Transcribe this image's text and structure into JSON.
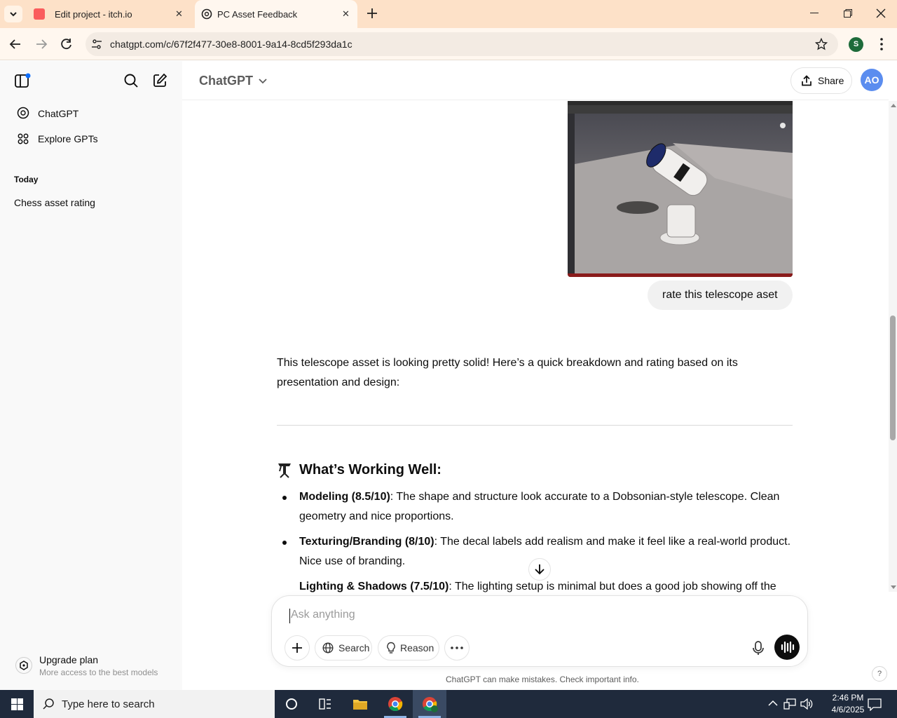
{
  "browser": {
    "tabs": [
      {
        "title": "Edit project - itch.io",
        "active": false
      },
      {
        "title": "PC Asset Feedback",
        "active": true
      }
    ],
    "url": "chatgpt.com/c/67f2f477-30e8-8001-9a14-8cd5f293da1c",
    "profile_initial": "S"
  },
  "sidebar": {
    "items": [
      {
        "label": "ChatGPT",
        "icon": "openai-logo-icon"
      },
      {
        "label": "Explore GPTs",
        "icon": "grid-icon"
      }
    ],
    "section_title": "Today",
    "history": [
      "Chess asset rating"
    ],
    "upgrade": {
      "title": "Upgrade plan",
      "subtitle": "More access to the best models"
    }
  },
  "header": {
    "model_label": "ChatGPT",
    "share_label": "Share",
    "avatar_initials": "AO"
  },
  "conversation": {
    "user_message": "rate this telescope aset",
    "assistant_intro": "This telescope asset is looking pretty solid! Here’s a quick breakdown and rating based on its presentation and design:",
    "section_heading": "What’s Working Well:",
    "section_icon": "telescope-emoji-icon",
    "bullets": [
      {
        "label": "Modeling (8.5/10)",
        "text": ": The shape and structure look accurate to a Dobsonian-style telescope. Clean geometry and nice proportions."
      },
      {
        "label": "Texturing/Branding (8/10)",
        "text": ": The decal labels add realism and make it feel like a real-world product. Nice use of branding."
      },
      {
        "label": "Lighting & Shadows (7.5/10)",
        "text": ": The lighting setup is minimal but does a good job showing off the"
      }
    ]
  },
  "composer": {
    "placeholder": "Ask anything",
    "search_label": "Search",
    "reason_label": "Reason",
    "disclaimer": "ChatGPT can make mistakes. Check important info.",
    "help_label": "?"
  },
  "taskbar": {
    "search_placeholder": "Type here to search",
    "time": "2:46 PM",
    "date": "4/6/2025"
  },
  "colors": {
    "tab_strip": "#fde1c8",
    "taskbar": "#1f2a3c",
    "accent_blue": "#0d6efd",
    "avatar_bg": "#5b8def",
    "voice_button": "#0d0d0d"
  }
}
